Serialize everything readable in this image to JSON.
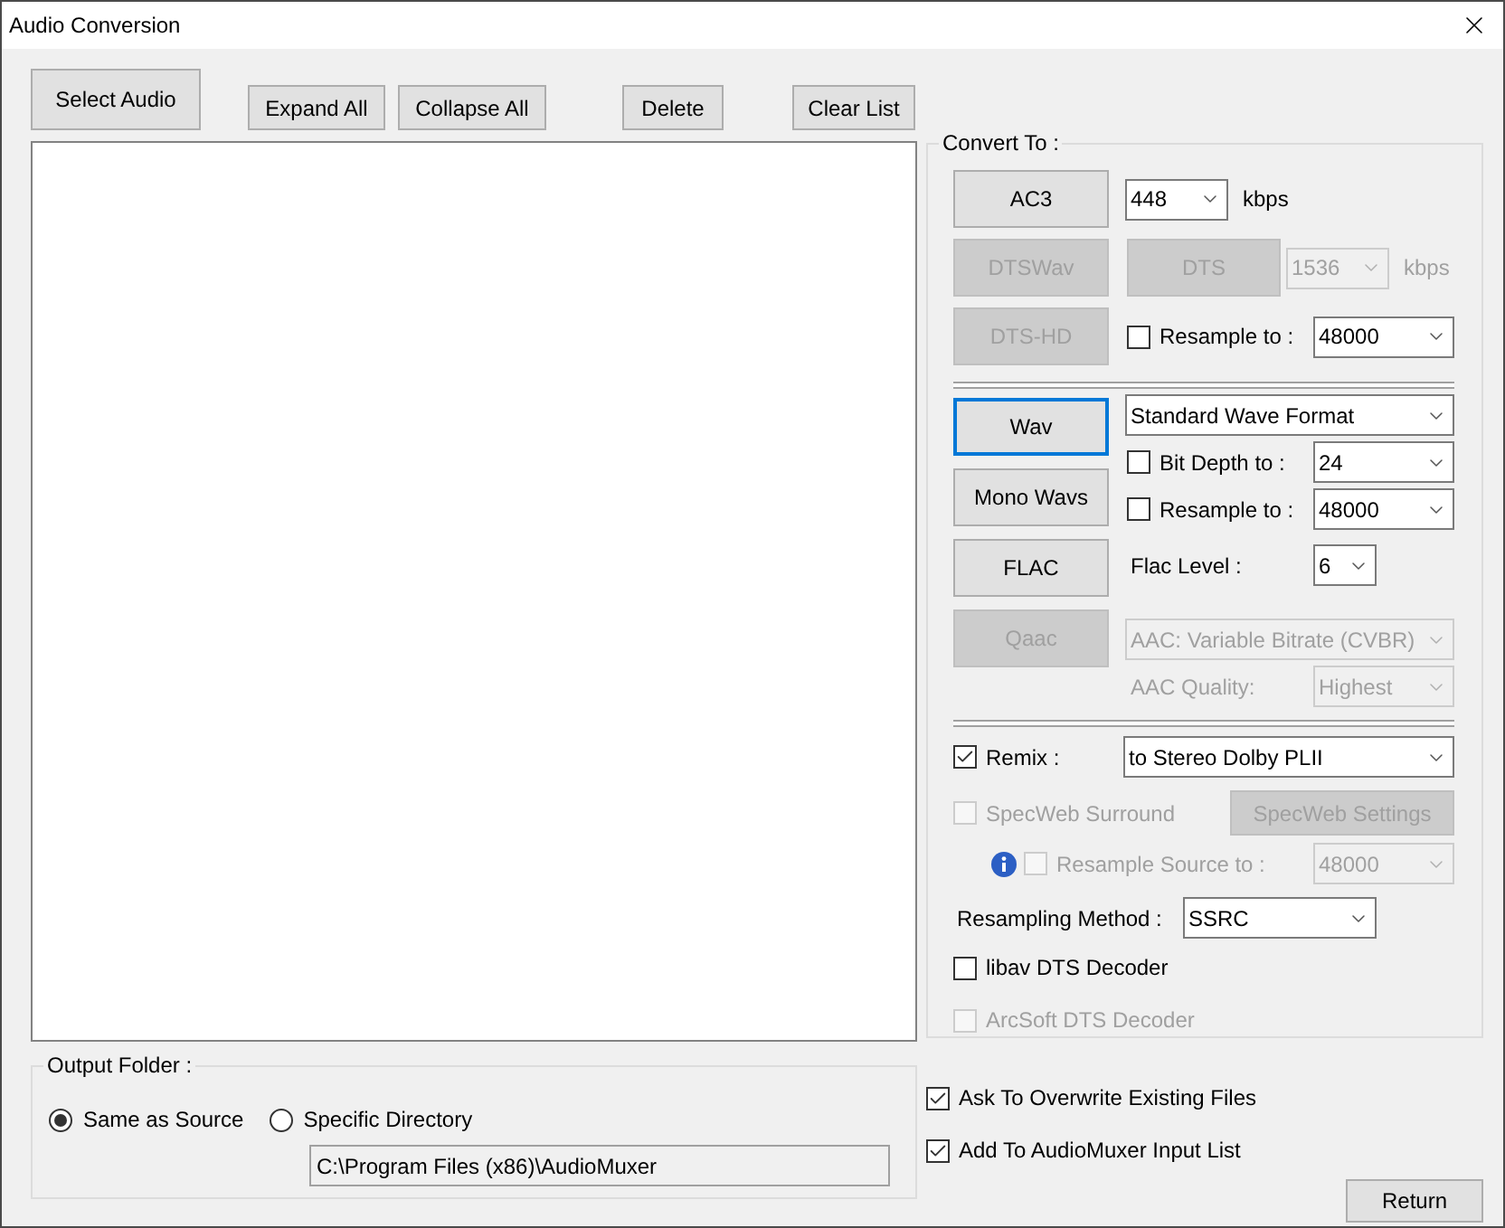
{
  "window": {
    "title": "Audio Conversion"
  },
  "toolbar": [
    {
      "label": "Select Audio"
    },
    {
      "label": "Expand All"
    },
    {
      "label": "Collapse All"
    },
    {
      "label": "Delete"
    },
    {
      "label": "Clear List"
    }
  ],
  "output_folder": {
    "title": "Output Folder :",
    "options": [
      {
        "label": "Same as Source",
        "selected": true
      },
      {
        "label": "Specific Directory",
        "selected": false
      }
    ],
    "path": "C:\\Program Files (x86)\\AudioMuxer"
  },
  "convert_to": {
    "title": "Convert To :",
    "surround_buttons": [
      {
        "label": "AC3",
        "disabled": false,
        "focused": false
      },
      {
        "label": "DTSWav",
        "disabled": true,
        "focused": false
      },
      {
        "label": "DTS-HD",
        "disabled": true,
        "focused": false
      }
    ],
    "ac3_bitrate": {
      "value": "448",
      "unit": "kbps"
    },
    "dts_button": {
      "label": "DTS",
      "disabled": true
    },
    "dts_bitrate": {
      "value": "1536",
      "unit": "kbps",
      "disabled": true
    },
    "surround_resample": {
      "label": "Resample to :",
      "checked": false,
      "value": "48000"
    },
    "pcm_buttons": [
      {
        "label": "Wav",
        "disabled": false,
        "focused": true
      },
      {
        "label": "Mono Wavs",
        "disabled": false,
        "focused": false
      },
      {
        "label": "FLAC",
        "disabled": false,
        "focused": false
      },
      {
        "label": "Qaac",
        "disabled": true,
        "focused": false
      }
    ],
    "wave_format": {
      "value": "Standard Wave Format"
    },
    "bit_depth": {
      "label": "Bit Depth to :",
      "checked": false,
      "value": "24"
    },
    "pcm_resample": {
      "label": "Resample to :",
      "checked": false,
      "value": "48000"
    },
    "flac_level": {
      "label": "Flac Level :",
      "value": "6"
    },
    "aac_mode": {
      "value": "AAC: Variable Bitrate (CVBR)",
      "disabled": true
    },
    "aac_quality": {
      "label": "AAC Quality:",
      "value": "Highest",
      "disabled": true
    },
    "remix": {
      "label": "Remix :",
      "checked": true,
      "value": "to Stereo Dolby PLII"
    },
    "specweb": {
      "label": "SpecWeb Surround",
      "checked": false,
      "disabled": true,
      "settings_label": "SpecWeb Settings"
    },
    "resample_source": {
      "label": "Resample Source to :",
      "checked": false,
      "disabled": true,
      "value": "48000"
    },
    "resampling_method": {
      "label": "Resampling Method :",
      "value": "SSRC"
    },
    "decoders": [
      {
        "label": "libav DTS Decoder",
        "checked": false,
        "disabled": false
      },
      {
        "label": "ArcSoft DTS Decoder",
        "checked": false,
        "disabled": true
      }
    ]
  },
  "options": [
    {
      "label": "Ask To Overwrite Existing Files",
      "checked": true
    },
    {
      "label": "Add To AudioMuxer Input List",
      "checked": true
    }
  ],
  "return_button": {
    "label": "Return"
  }
}
